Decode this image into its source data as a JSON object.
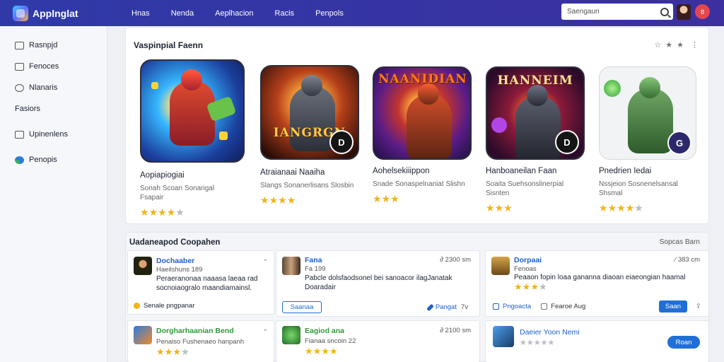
{
  "header": {
    "app_name": "Applnglat",
    "nav": [
      "Hnas",
      "Nenda",
      "Aeplhacion",
      "Racis",
      "Penpols"
    ],
    "search_placeholder": "Saengaun",
    "notif_label": "8"
  },
  "sidebar": {
    "items": [
      {
        "label": "Rasnpjd",
        "icon": "grid-icon"
      },
      {
        "label": "Fenoces",
        "icon": "folder-icon"
      },
      {
        "label": "Nlanaris",
        "icon": "chat-icon"
      },
      {
        "label": "Fasiors",
        "icon": ""
      },
      {
        "label": "Upinenlens",
        "icon": "list-icon"
      },
      {
        "label": "Penopis",
        "icon": "globe-icon"
      }
    ]
  },
  "featured": {
    "title": "Vaspinpial Faenn",
    "tools": [
      "☆",
      "★",
      "★",
      "⋮"
    ],
    "apps": [
      {
        "name": "Aopiapiogiai",
        "desc": "Sonah Scoan Sonarigal Fsapair",
        "rating": 4,
        "art_text": "",
        "badge": ""
      },
      {
        "name": "Atraianaai Naaiha",
        "desc": "Slangs Sonanerlisans Slosbin",
        "rating": 4,
        "art_text": "IANGRGN",
        "badge": "D"
      },
      {
        "name": "Aohelsekiiippon",
        "desc": "Snade Sonaspelnaniat Slishn",
        "rating": 3,
        "art_text": "NAANIDIAN",
        "badge": ""
      },
      {
        "name": "Hanboaneilan Faan",
        "desc": "Soaita Suehsonslinerpial Sisnten",
        "rating": 3,
        "art_text": "HANNEIM",
        "badge": "D"
      },
      {
        "name": "Pnedrien Iedai",
        "desc": "Nssjeion Sosnenelsansal Shsmal",
        "rating": 4,
        "art_text": "",
        "badge": "G"
      }
    ]
  },
  "updates": {
    "title": "Uadaneapod Coopahen",
    "link": "Sopcas Barn",
    "cards": [
      {
        "name": "Dochaaber",
        "sub": "Haeilshuns 189",
        "meta": "",
        "message": "Peraeranonaa naaasa laeaa rad socnoiaogralo maandiamainsl.",
        "footer": "Senale pngpanar"
      },
      {
        "name": "Fana",
        "sub": "Fa 199",
        "meta": "∂ 2300 sm",
        "message": "Pabcle dolsfaodsonel bei sanoacor ilagJanatak Doaradair",
        "footer": "Pangat",
        "button": "Saanaa",
        "extra": "7v"
      },
      {
        "name": "Dorpaai",
        "sub": "Fenoas",
        "meta": "⁄ 383 cm",
        "message": "Peaaon fopin loaa gananna diaoan eiaeongian haamal",
        "rating": 3,
        "footer": "Pngoacta",
        "footer2": "Fearoe Aug",
        "button": "Saan"
      },
      {
        "name": "Dorgharhaanian Bend",
        "sub": "Penaiso Fushenaeo hanpanh",
        "rating": 3
      },
      {
        "name": "Eagiod ana",
        "sub": "Fianaa sncoin 22",
        "meta": "∂ 2100 sm",
        "rating": 4
      },
      {
        "name": "Daeier Yoon Nemi",
        "rating": 0,
        "button": "Roan"
      }
    ]
  },
  "colors": {
    "topbar": "#2f3aa8",
    "accent": "#1f6fd6",
    "star": "#f0b419",
    "green": "#2f9a3b",
    "blue": "#1f5fd0"
  }
}
